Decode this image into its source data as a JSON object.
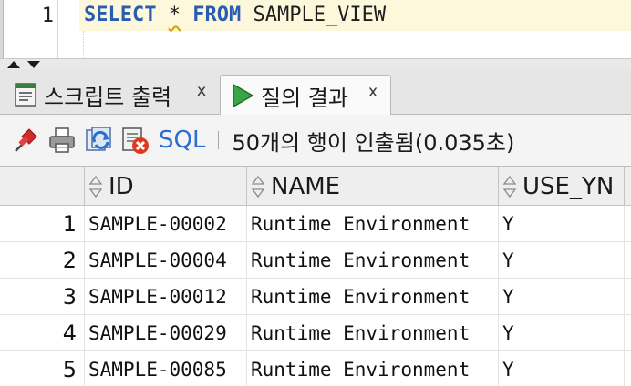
{
  "editor": {
    "line_number": "1",
    "keyword_select": "SELECT",
    "star": "*",
    "keyword_from": "FROM",
    "table_name": "SAMPLE_VIEW"
  },
  "tabs": [
    {
      "label": "스크립트 출력",
      "close": "x",
      "icon": "script-output-icon",
      "active": false
    },
    {
      "label": "질의 결과",
      "close": "x",
      "icon": "run-query-icon",
      "active": true
    }
  ],
  "toolbar": {
    "icons": [
      "pin-icon",
      "print-icon",
      "refresh-icon",
      "cancel-fetch-icon"
    ],
    "sql_label": "SQL",
    "status": "50개의 행이 인출됨(0.035초)"
  },
  "grid": {
    "columns": [
      "ID",
      "NAME",
      "USE_YN"
    ],
    "rows": [
      {
        "num": "1",
        "id": "SAMPLE-00002",
        "name": "Runtime Environment",
        "use_yn": "Y"
      },
      {
        "num": "2",
        "id": "SAMPLE-00004",
        "name": "Runtime Environment",
        "use_yn": "Y"
      },
      {
        "num": "3",
        "id": "SAMPLE-00012",
        "name": "Runtime Environment",
        "use_yn": "Y"
      },
      {
        "num": "4",
        "id": "SAMPLE-00029",
        "name": "Runtime Environment",
        "use_yn": "Y"
      },
      {
        "num": "5",
        "id": "SAMPLE-00085",
        "name": "Runtime Environment",
        "use_yn": "Y"
      }
    ]
  },
  "colors": {
    "keyword": "#2a5db0",
    "sql_link": "#2a6fcf",
    "current_line": "#fdf7dc",
    "run_icon": "#2e9e3a",
    "pin_icon": "#d32a2a"
  }
}
